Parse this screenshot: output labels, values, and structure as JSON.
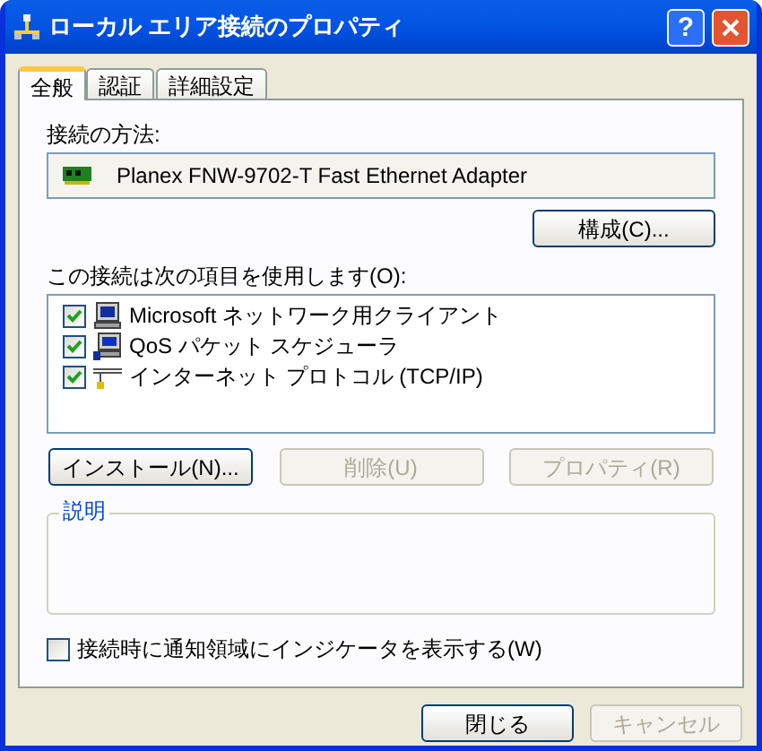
{
  "window": {
    "title": "ローカル エリア接続のプロパティ",
    "help": "?"
  },
  "tabs": [
    {
      "label": "全般",
      "selected": true
    },
    {
      "label": "認証",
      "selected": false
    },
    {
      "label": "詳細設定",
      "selected": false
    }
  ],
  "connect_using": {
    "label": "接続の方法:",
    "adapter": "Planex FNW-9702-T Fast Ethernet Adapter",
    "configure": "構成(C)..."
  },
  "components": {
    "label": "この接続は次の項目を使用します(O):",
    "items": [
      {
        "kind": "client",
        "label": "Microsoft ネットワーク用クライアント",
        "checked": true
      },
      {
        "kind": "service",
        "label": "QoS パケット スケジューラ",
        "checked": true
      },
      {
        "kind": "protocol",
        "label": "インターネット プロトコル (TCP/IP)",
        "checked": true
      }
    ]
  },
  "item_buttons": [
    {
      "label": "インストール(N)...",
      "disabled": false
    },
    {
      "label": "削除(U)",
      "disabled": true
    },
    {
      "label": "プロパティ(R)",
      "disabled": true
    }
  ],
  "description": {
    "title": "説明"
  },
  "show_icon": {
    "label": "接続時に通知領域にインジケータを表示する(W)",
    "checked": false
  },
  "dialog_buttons": [
    {
      "label": "閉じる",
      "disabled": false
    },
    {
      "label": "キャンセル",
      "disabled": true
    }
  ]
}
